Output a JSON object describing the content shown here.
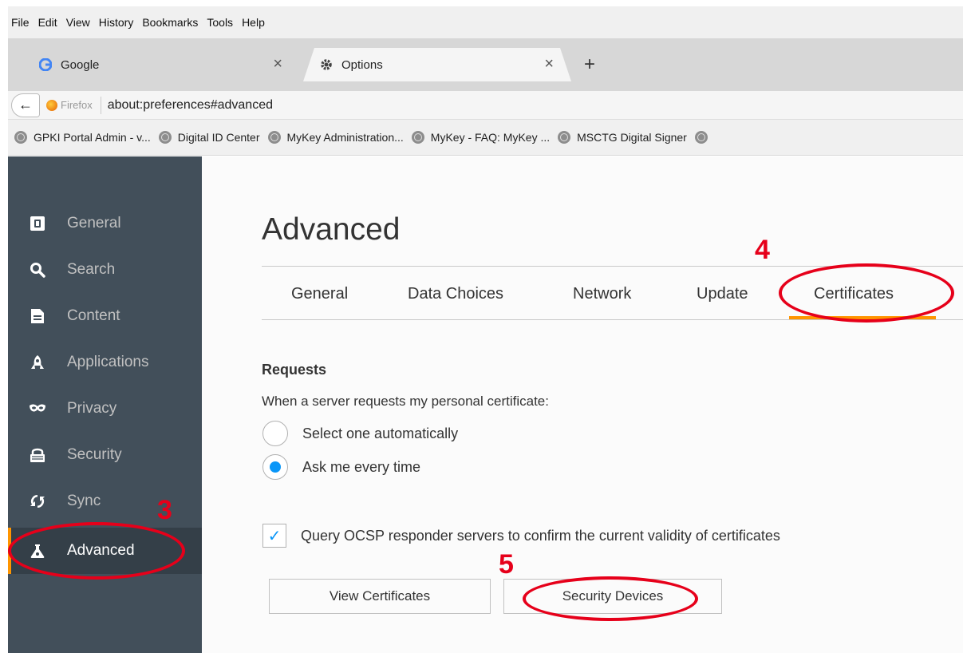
{
  "menubar": {
    "items": [
      "File",
      "Edit",
      "View",
      "History",
      "Bookmarks",
      "Tools",
      "Help"
    ]
  },
  "tabs": [
    {
      "label": "Google",
      "icon": "google-icon",
      "close": "×"
    },
    {
      "label": "Options",
      "icon": "gear-icon",
      "close": "×"
    }
  ],
  "new_tab": "+",
  "navbar": {
    "identity": "Firefox",
    "url": "about:preferences#advanced"
  },
  "bookmarks": [
    "GPKI Portal Admin - v...",
    "Digital ID Center",
    "MyKey Administration...",
    "MyKey - FAQ: MyKey ...",
    "MSCTG Digital Signer"
  ],
  "sidebar": {
    "items": [
      {
        "label": "General",
        "icon": "general-icon"
      },
      {
        "label": "Search",
        "icon": "search-icon"
      },
      {
        "label": "Content",
        "icon": "content-icon"
      },
      {
        "label": "Applications",
        "icon": "applications-icon"
      },
      {
        "label": "Privacy",
        "icon": "privacy-mask-icon"
      },
      {
        "label": "Security",
        "icon": "security-icon"
      },
      {
        "label": "Sync",
        "icon": "sync-icon"
      },
      {
        "label": "Advanced",
        "icon": "advanced-icon",
        "selected": true
      }
    ]
  },
  "main": {
    "title": "Advanced",
    "tabs": [
      "General",
      "Data Choices",
      "Network",
      "Update",
      "Certificates"
    ],
    "active_tab": "Certificates",
    "requests": {
      "heading": "Requests",
      "description": "When a server requests my personal certificate:",
      "options": [
        {
          "label": "Select one automatically",
          "selected": false
        },
        {
          "label": "Ask me every time",
          "selected": true
        }
      ]
    },
    "ocsp": {
      "label": "Query OCSP responder servers to confirm the current validity of certificates",
      "checked": true
    },
    "buttons": {
      "view_certificates": "View Certificates",
      "security_devices": "Security Devices"
    }
  },
  "annotations": {
    "step3": "3",
    "step4": "4",
    "step5": "5"
  },
  "colors": {
    "accent": "#ff9500",
    "annotation": "#e6001a",
    "sidebar": "#424f5a",
    "radio": "#0996f8"
  }
}
